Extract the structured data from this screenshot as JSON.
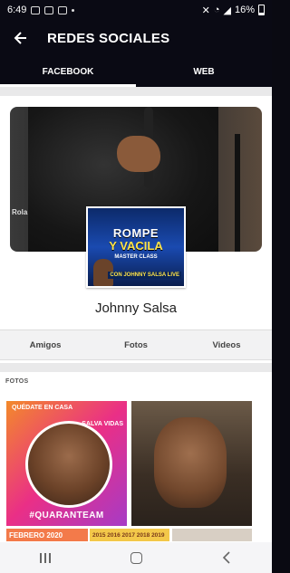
{
  "status": {
    "time": "6:49",
    "battery": "16%"
  },
  "appbar": {
    "back_icon": "arrow-left-icon",
    "title": "REDES SOCIALES"
  },
  "tabs": [
    {
      "label": "FACEBOOK",
      "active": true
    },
    {
      "label": "WEB",
      "active": false
    }
  ],
  "profile": {
    "cover_brand": "Rola",
    "avatar_poster": {
      "line1": "ROMPE",
      "line2": "Y VACILA",
      "line3": "MASTER CLASS",
      "line4": "CON JOHNNY SALSA LIVE"
    },
    "name": "Johnny Salsa",
    "tabs": [
      "Amigos",
      "Fotos",
      "Videos"
    ]
  },
  "photos": {
    "header": "FOTOS",
    "tile1": {
      "top": "QUÉDATE EN CASA",
      "right": "SALVA VIDAS",
      "bottom": "#QUARANTEAM"
    },
    "tile3_text": "FEBRERO 2020",
    "tile4_text": "2015 2016 2017 2018 2019"
  },
  "colors": {
    "appbar": "#0a0a14",
    "accent": "#ffffff"
  }
}
